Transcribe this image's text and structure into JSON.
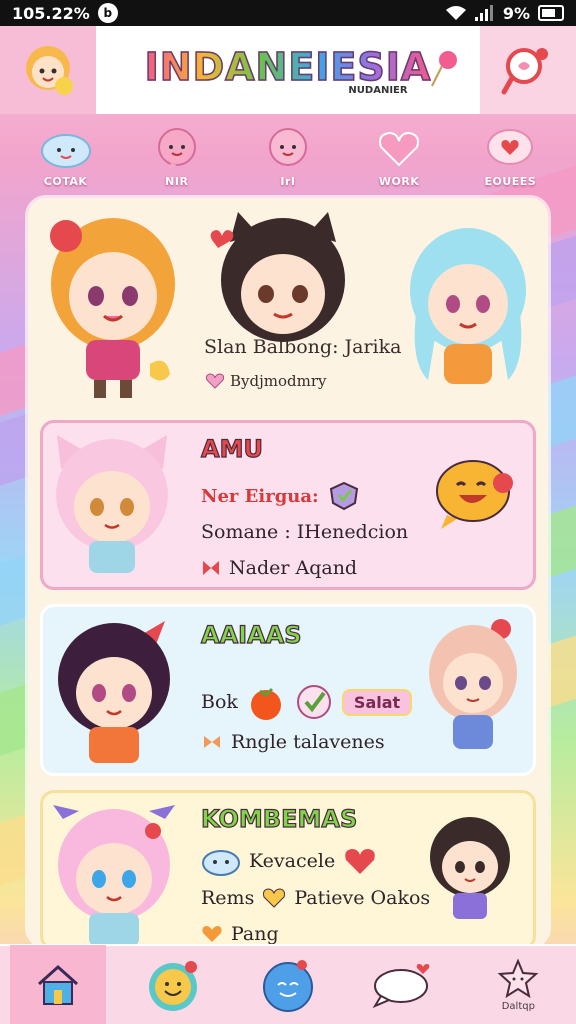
{
  "status_bar": {
    "time": "105.22%",
    "battery": "9%"
  },
  "header": {
    "title": "INDANEIESIA",
    "subtitle": "NUDANIER"
  },
  "nav": [
    {
      "label": "COTAK",
      "icon": "cloud-face-icon"
    },
    {
      "label": "NIR",
      "icon": "chat-face-icon"
    },
    {
      "label": "IrI",
      "icon": "chat-face-icon"
    },
    {
      "label": "WORK",
      "icon": "heart-chat-icon"
    },
    {
      "label": "EOUEES",
      "icon": "heart-bubble-icon"
    }
  ],
  "hero": {
    "text": "Slan Balbong: Jarika",
    "sub": "Bydjmodmry"
  },
  "cards": [
    {
      "name": "AMU",
      "line1": "Ner Eirgua:",
      "line2": "Somane : IHenedcion",
      "line3": "Nader Aqand"
    },
    {
      "name": "AAIAAS",
      "line1": "Bok",
      "badge": "Salat",
      "line2": "Rngle talavenes"
    },
    {
      "name": "KOMBEMAS",
      "line1": "Kevacele",
      "line2": "Rems",
      "line2b": "Patieve Oakos",
      "line3": "Pang"
    }
  ],
  "tabbar": [
    {
      "icon": "home-icon",
      "label": ""
    },
    {
      "icon": "smiley-icon",
      "label": ""
    },
    {
      "icon": "blue-smiley-icon",
      "label": ""
    },
    {
      "icon": "chat-cloud-icon",
      "label": ""
    },
    {
      "icon": "star-face-icon",
      "label": "Daltqp"
    }
  ],
  "colors": {
    "pink": "#f3a5cb",
    "panel": "#fdf3e2",
    "accent_red": "#e5484d"
  }
}
